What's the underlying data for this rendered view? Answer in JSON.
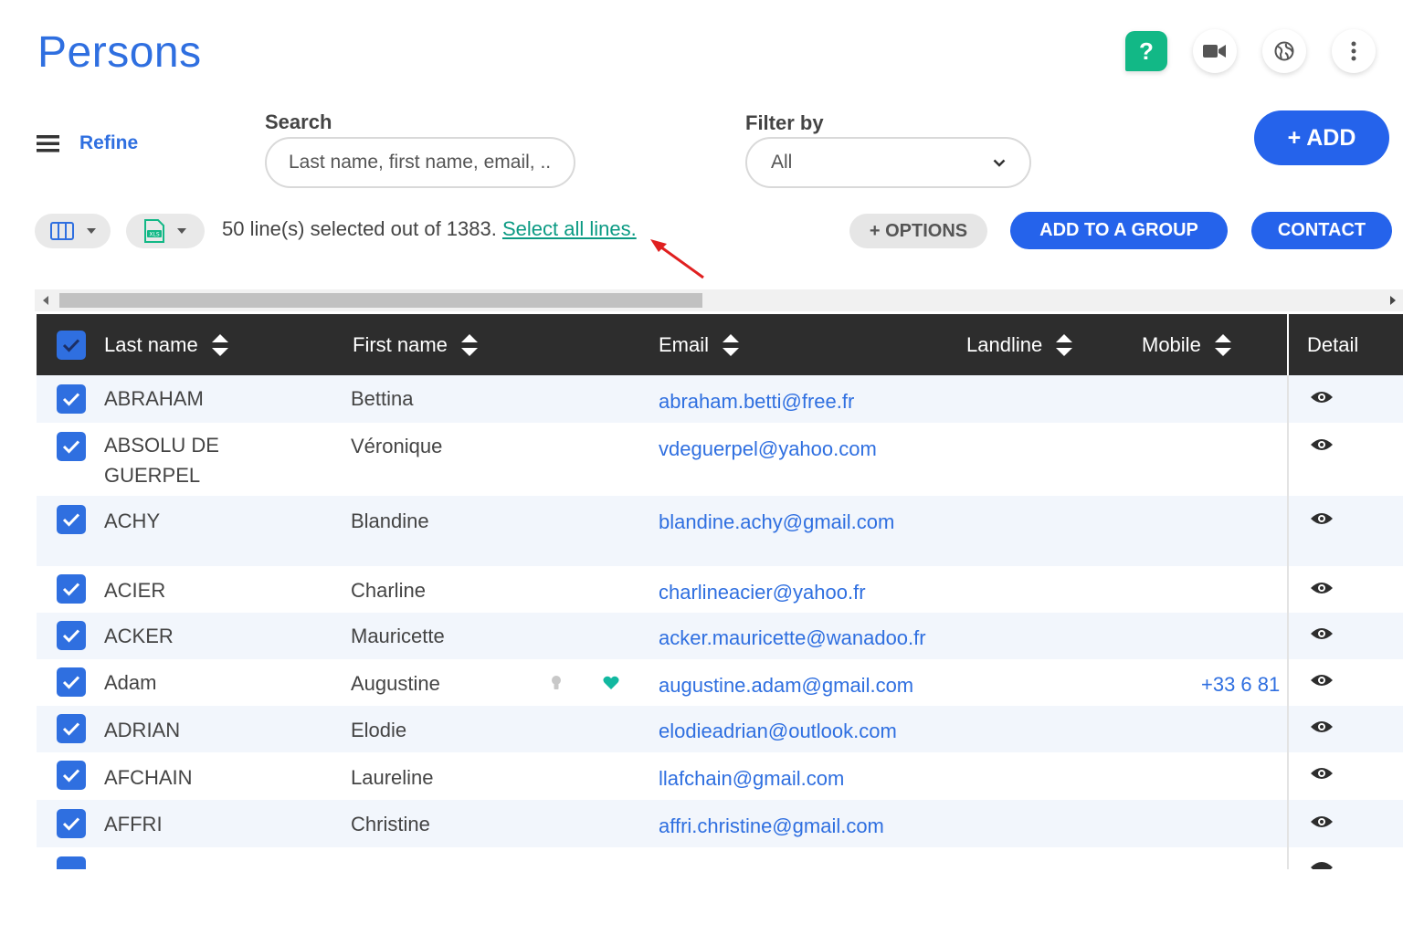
{
  "header": {
    "title": "Persons",
    "help_label": "?"
  },
  "refine": {
    "label": "Refine"
  },
  "search": {
    "label": "Search",
    "placeholder": "Last name, first name, email, ..."
  },
  "filter": {
    "label": "Filter by",
    "value": "All"
  },
  "actions": {
    "add_label": "+ ADD",
    "options_label": "+ OPTIONS",
    "group_label": "ADD TO A GROUP",
    "contact_label": "CONTACT"
  },
  "selection": {
    "text": "50 line(s) selected out of 1383.",
    "link": "Select all lines."
  },
  "table": {
    "columns": {
      "last_name": "Last name",
      "first_name": "First name",
      "email": "Email",
      "landline": "Landline",
      "mobile": "Mobile",
      "detail": "Detail"
    },
    "rows": [
      {
        "last_name": "ABRAHAM",
        "first_name": "Bettina",
        "email": "abraham.betti@free.fr",
        "mobile": ""
      },
      {
        "last_name": "ABSOLU DE",
        "last_name_2": "GUERPEL",
        "first_name": "Véronique",
        "email": "vdeguerpel@yahoo.com",
        "mobile": ""
      },
      {
        "last_name": "ACHY",
        "first_name": "Blandine",
        "email": "blandine.achy@gmail.com",
        "mobile": ""
      },
      {
        "last_name": "ACIER",
        "first_name": "Charline",
        "email": "charlineacier@yahoo.fr",
        "mobile": ""
      },
      {
        "last_name": "ACKER",
        "first_name": "Mauricette",
        "email": "acker.mauricette@wanadoo.fr",
        "mobile": ""
      },
      {
        "last_name": "Adam",
        "first_name": "Augustine",
        "email": "augustine.adam@gmail.com",
        "mobile": "+33 6 81"
      },
      {
        "last_name": "ADRIAN",
        "first_name": "Elodie",
        "email": "elodieadrian@outlook.com",
        "mobile": ""
      },
      {
        "last_name": "AFCHAIN",
        "first_name": "Laureline",
        "email": "llafchain@gmail.com",
        "mobile": ""
      },
      {
        "last_name": "AFFRI",
        "first_name": "Christine",
        "email": "affri.christine@gmail.com",
        "mobile": ""
      }
    ]
  },
  "colors": {
    "accent": "#2563eb",
    "link_green": "#0b9a83",
    "header_dark": "#2d2d2d",
    "help_green": "#12b886"
  }
}
